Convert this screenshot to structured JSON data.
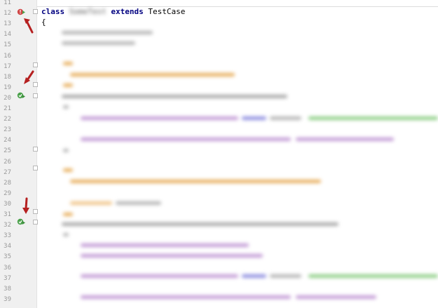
{
  "editor": {
    "line_numbers": [
      "11",
      "12",
      "13",
      "14",
      "15",
      "16",
      "17",
      "18",
      "19",
      "20",
      "21",
      "22",
      "23",
      "24",
      "25",
      "26",
      "27",
      "28",
      "29",
      "30",
      "31",
      "32",
      "33",
      "34",
      "35",
      "36",
      "37",
      "38",
      "39"
    ],
    "code": {
      "class_keyword": "class",
      "class_name_hidden": "SomeTest",
      "extends_keyword": "extends",
      "parent_class": "TestCase",
      "open_brace": "{"
    },
    "gutter_icons": [
      {
        "line": "12",
        "icon": "run-class-error-icon"
      },
      {
        "line": "20",
        "icon": "run-method-passed-icon"
      },
      {
        "line": "32",
        "icon": "run-method-passed-icon"
      }
    ],
    "annotation_arrows": [
      "red-arrow-icon",
      "red-arrow-icon",
      "red-arrow-icon"
    ],
    "colors": {
      "gutter_bg": "#f0f0f0",
      "line_number": "#999999",
      "keyword": "#000080",
      "comment": "#d99a3a",
      "string": "#67b85a",
      "variable": "#9a4fc0",
      "arrow": "#b52020",
      "run_green": "#4aa04a",
      "error_red": "#d04545"
    }
  }
}
